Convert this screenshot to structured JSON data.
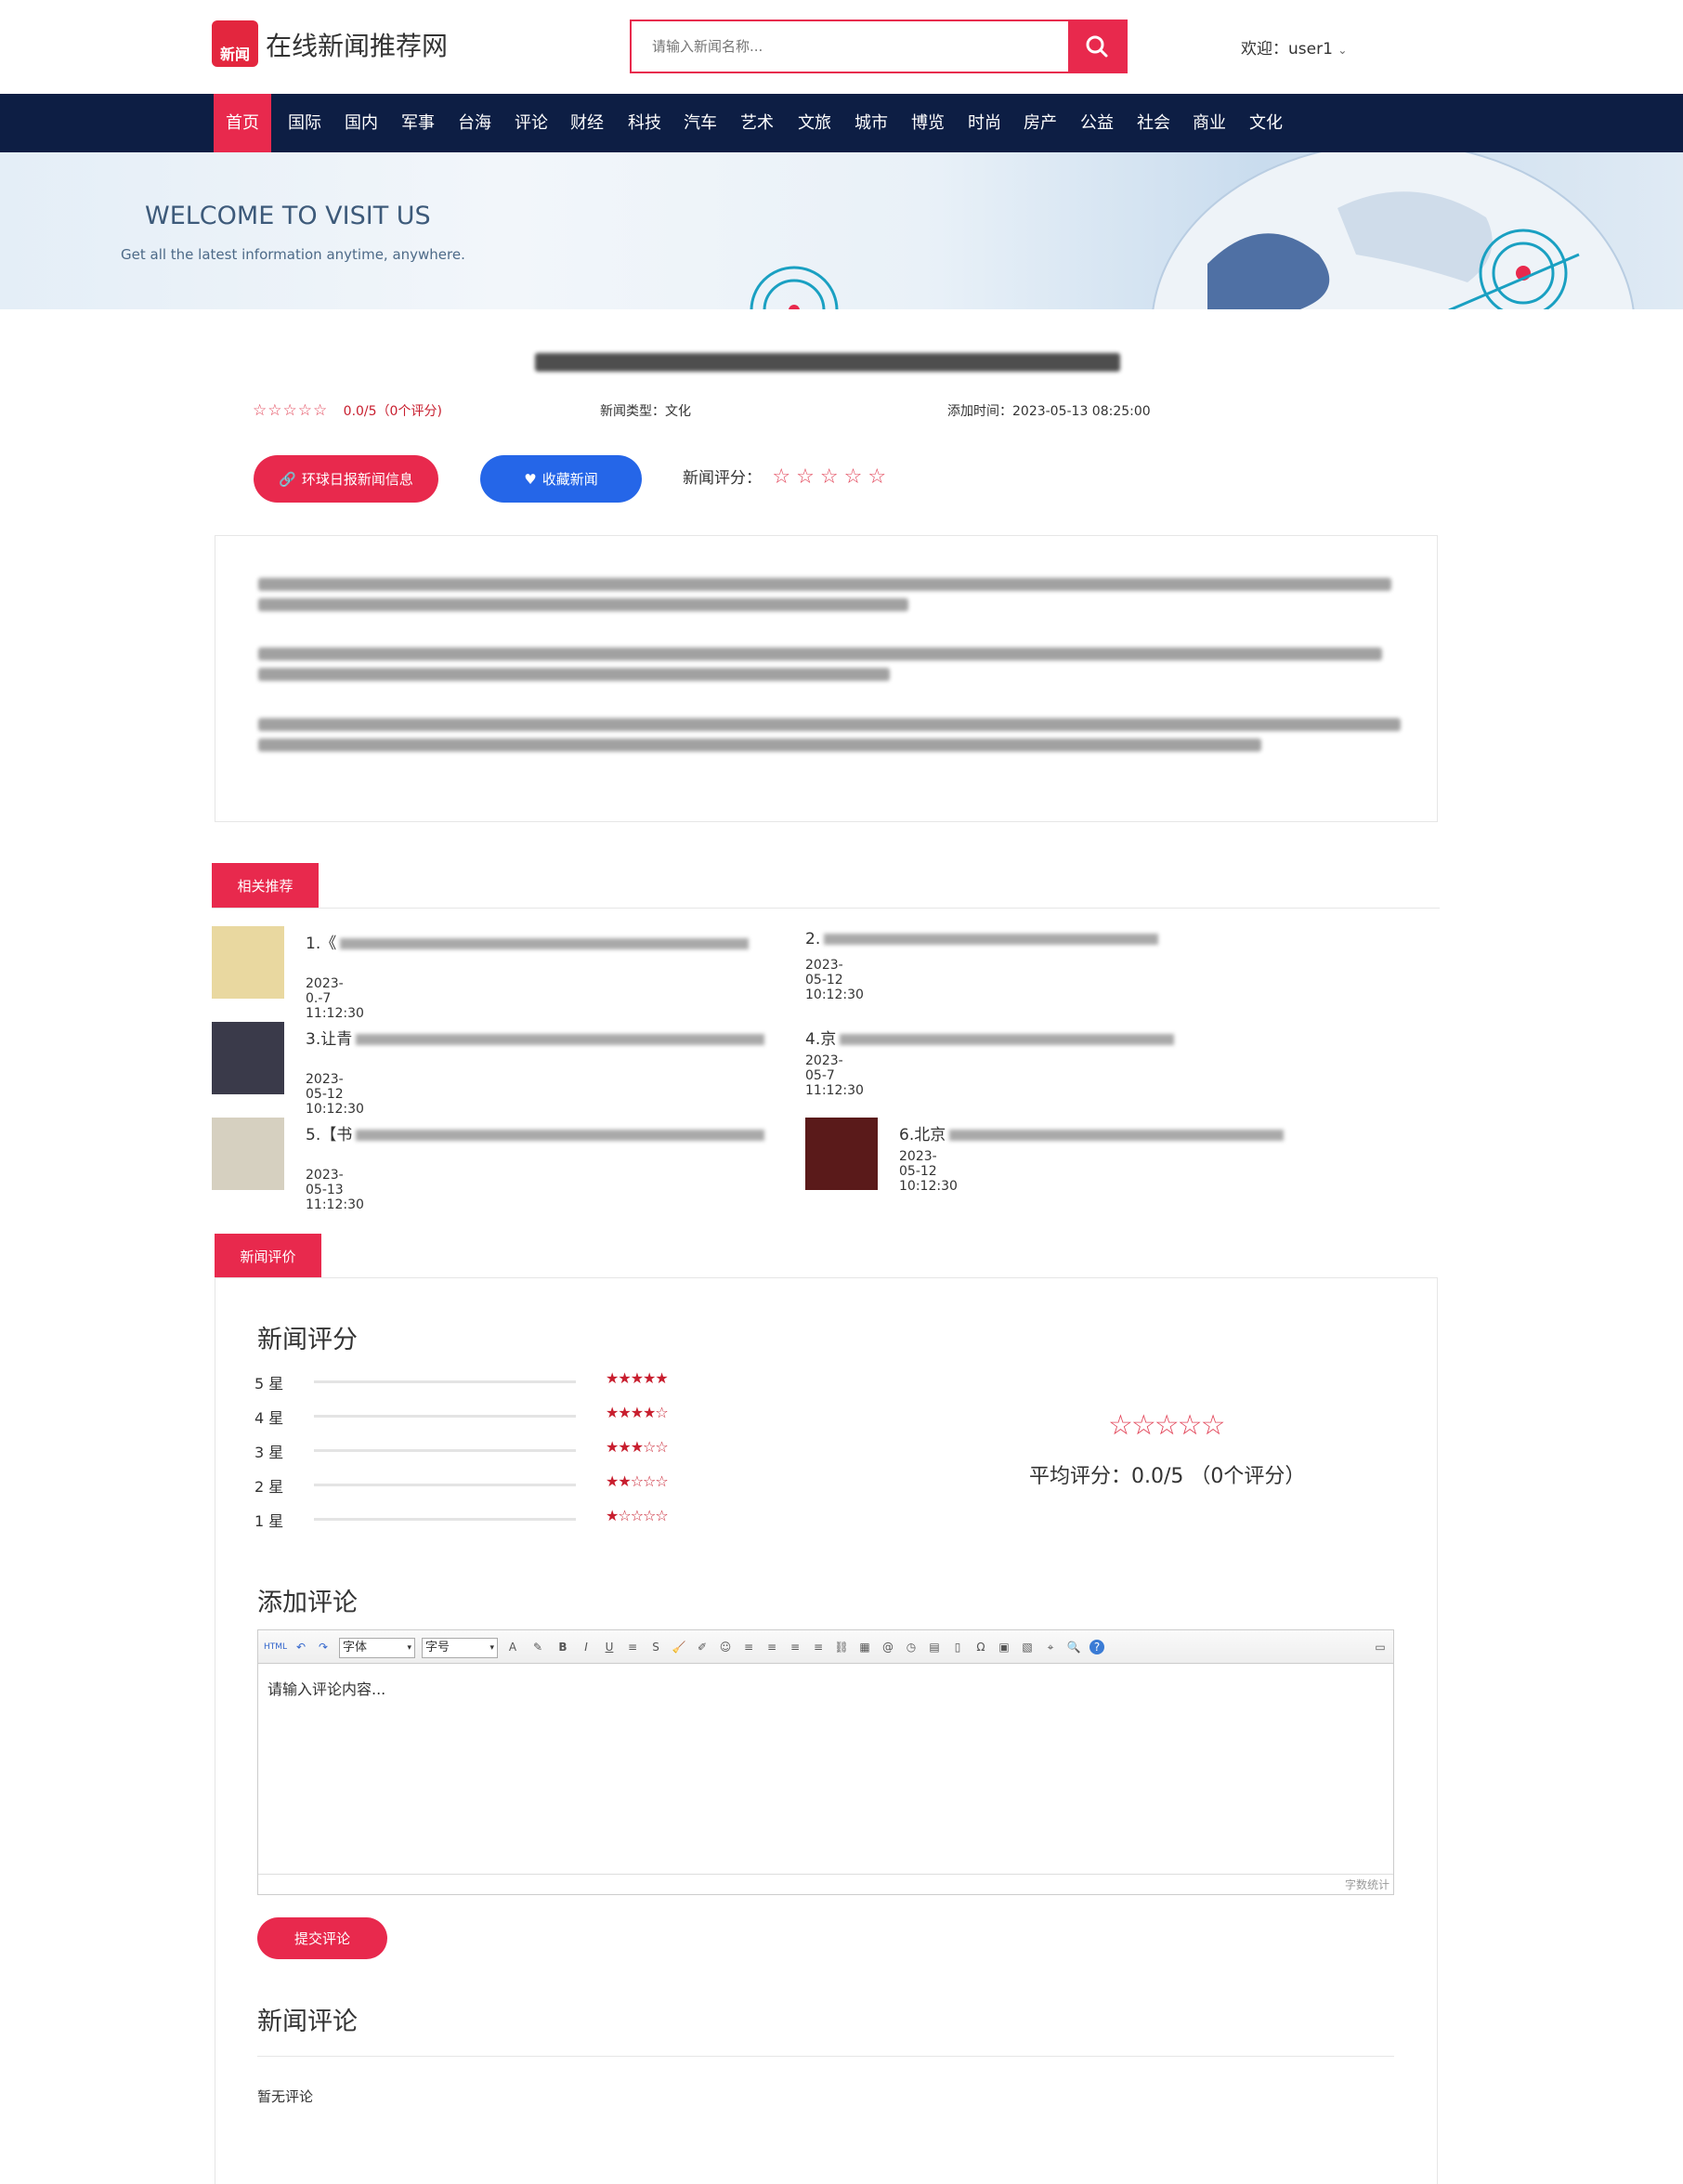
{
  "header": {
    "logo_badge": "新闻",
    "site_name": "在线新闻推荐网",
    "search_placeholder": "请输入新闻名称...",
    "welcome": "欢迎：user1"
  },
  "nav": [
    "首页",
    "国际",
    "国内",
    "军事",
    "台海",
    "评论",
    "财经",
    "科技",
    "汽车",
    "艺术",
    "文旅",
    "城市",
    "博览",
    "时尚",
    "房产",
    "公益",
    "社会",
    "商业",
    "文化"
  ],
  "banner": {
    "title": "WELCOME TO VISIT US",
    "subtitle": "Get all the latest information anytime, anywhere."
  },
  "article": {
    "rating_summary": "0.0/5（0个评分)",
    "category": "新闻类型：文化",
    "added_time": "添加时间：2023-05-13 08:25:00",
    "source_button": "环球日报新闻信息",
    "favorite_button": "收藏新闻",
    "rate_label": "新闻评分："
  },
  "related": {
    "tab": "相关推荐",
    "items": [
      {
        "title": "1.《",
        "date": "2023-0.-7 11:12:30"
      },
      {
        "title": "2.",
        "date": "2023-05-12 10:12:30"
      },
      {
        "title": "3.让青",
        "date": "2023-05-12 10:12:30"
      },
      {
        "title": "4.京",
        "date": "2023-05-7 11:12:30"
      },
      {
        "title": "5.【书",
        "date": "2023-05-13 11:12:30"
      },
      {
        "title": "6.北京",
        "date": "2023-05-12 10:12:30"
      }
    ]
  },
  "evaluation": {
    "tab": "新闻评价",
    "rating_heading": "新闻评分",
    "bars": [
      {
        "label": "5 星",
        "stars": 5,
        "fraction": 0
      },
      {
        "label": "4 星",
        "stars": 4,
        "fraction": 0
      },
      {
        "label": "3 星",
        "stars": 3,
        "fraction": 0
      },
      {
        "label": "2 星",
        "stars": 2,
        "fraction": 0
      },
      {
        "label": "1 星",
        "stars": 1,
        "fraction": 0
      }
    ],
    "average": "平均评分：0.0/5 （0个评分）",
    "add_comment_heading": "添加评论",
    "font_select": "字体",
    "size_select": "字号",
    "editor_placeholder": "请输入评论内容...",
    "word_count": "字数统计",
    "submit_button": "提交评论",
    "comments_heading": "新闻评论",
    "no_comments": "暂无评论"
  },
  "colors": {
    "accent": "#e8294d",
    "nav_bg": "#0d1e44",
    "blue": "#2566e8"
  }
}
